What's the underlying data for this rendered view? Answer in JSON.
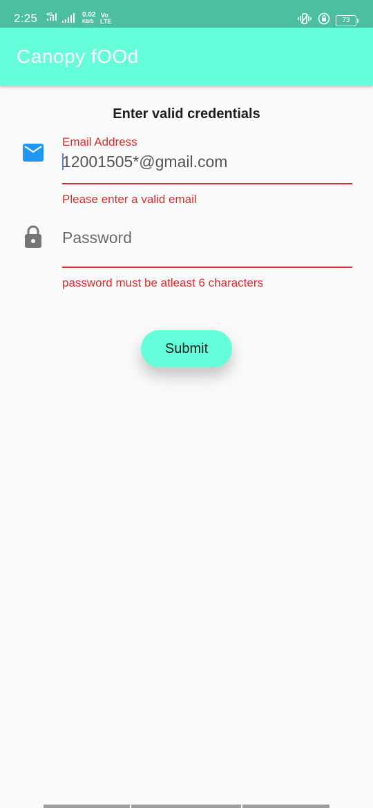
{
  "status_bar": {
    "time": "2:25",
    "network_speed": "0.02",
    "speed_unit": "KB/S",
    "volte": "Vo",
    "lte": "LTE",
    "net_4g": "4G",
    "battery": "73"
  },
  "app_bar": {
    "title": "Canopy fOOd"
  },
  "form": {
    "heading": "Enter valid credentials",
    "email": {
      "label": "Email Address",
      "value": "12001505*@gmail.com",
      "error": "Please enter a valid email",
      "icon": "mail-icon"
    },
    "password": {
      "placeholder": "Password",
      "error": "password must be atleast 6 characters",
      "icon": "lock-icon"
    },
    "submit_label": "Submit"
  },
  "colors": {
    "status_bar": "#4CBFA0",
    "accent": "#64FFDA",
    "error": "#D32F2F",
    "icon_blue": "#2196F3",
    "icon_gray": "#757575"
  }
}
